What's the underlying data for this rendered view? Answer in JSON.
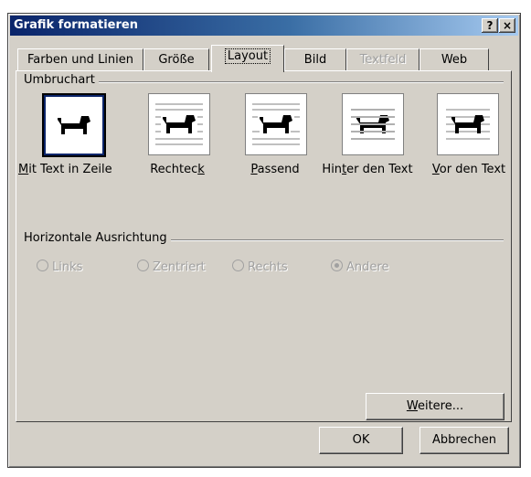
{
  "window": {
    "title": "Grafik formatieren",
    "help_label": "?",
    "close_label": "×"
  },
  "tabs": [
    {
      "label": "Farben und Linien",
      "state": "normal"
    },
    {
      "label": "Größe",
      "state": "normal"
    },
    {
      "label": "Layout",
      "state": "active"
    },
    {
      "label": "Bild",
      "state": "normal"
    },
    {
      "label": "Textfeld",
      "state": "disabled"
    },
    {
      "label": "Web",
      "state": "normal"
    }
  ],
  "wrap_group": {
    "label": "Umbruchart",
    "options": [
      {
        "label_pre": "",
        "label_ul": "M",
        "label_post": "it Text in Zeile",
        "selected": true,
        "icon": "inline-dog-icon"
      },
      {
        "label_pre": "Rechtec",
        "label_ul": "k",
        "label_post": "",
        "selected": false,
        "icon": "square-wrap-dog-icon"
      },
      {
        "label_pre": "",
        "label_ul": "P",
        "label_post": "assend",
        "selected": false,
        "icon": "tight-wrap-dog-icon"
      },
      {
        "label_pre": "Hin",
        "label_ul": "t",
        "label_post": "er den Text",
        "selected": false,
        "icon": "behind-text-dog-icon"
      },
      {
        "label_pre": "",
        "label_ul": "V",
        "label_post": "or den Text",
        "selected": false,
        "icon": "in-front-dog-icon"
      }
    ]
  },
  "align_group": {
    "label": "Horizontale Ausrichtung",
    "options": [
      {
        "label": "Links",
        "checked": false,
        "enabled": false
      },
      {
        "label": "Zentriert",
        "checked": false,
        "enabled": false
      },
      {
        "label": "Rechts",
        "checked": false,
        "enabled": false
      },
      {
        "label": "Andere",
        "checked": true,
        "enabled": false
      }
    ]
  },
  "buttons": {
    "more_pre": "",
    "more_ul": "W",
    "more_post": "eitere...",
    "ok": "OK",
    "cancel": "Abbrechen"
  },
  "colors": {
    "title_start": "#0a246a",
    "title_end": "#a6caf0",
    "face": "#d4d0c8",
    "disabled_text": "#a0a0a0"
  }
}
